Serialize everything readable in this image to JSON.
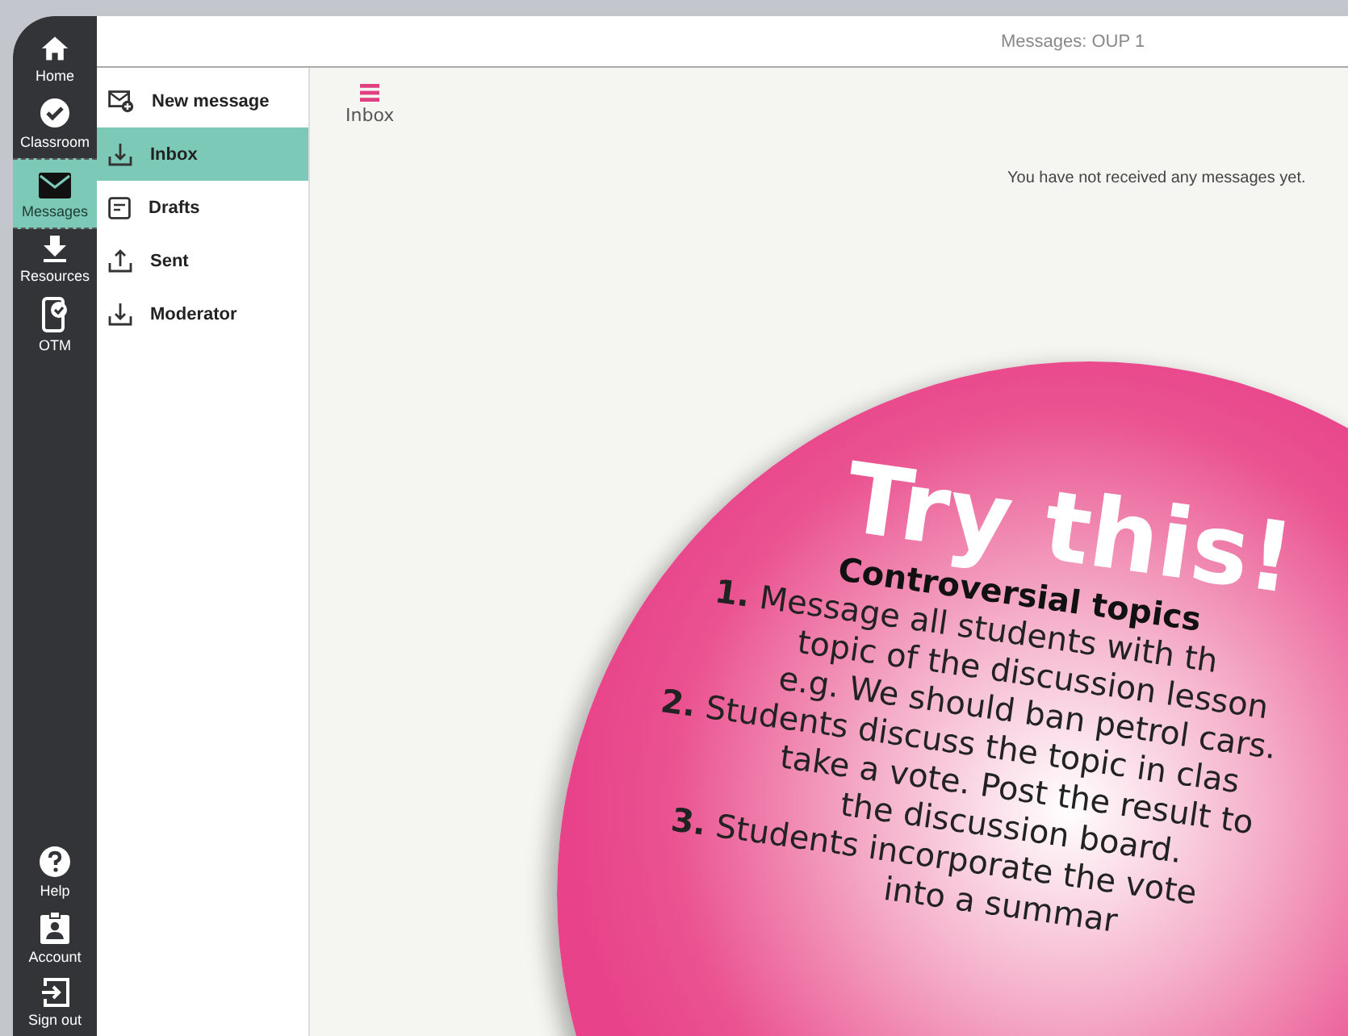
{
  "window": {
    "title": "Messages: OUP 1"
  },
  "nav_rail": {
    "items": [
      {
        "label": "Home",
        "selected": false
      },
      {
        "label": "Classroom",
        "selected": false
      },
      {
        "label": "Messages",
        "selected": true
      },
      {
        "label": "Resources",
        "selected": false
      },
      {
        "label": "OTM",
        "selected": false
      }
    ],
    "bottom_items": [
      {
        "label": "Help"
      },
      {
        "label": "Account"
      },
      {
        "label": "Sign out"
      }
    ]
  },
  "sidebar": {
    "items": [
      {
        "label": "New message",
        "selected": false
      },
      {
        "label": "Inbox",
        "selected": true
      },
      {
        "label": "Drafts",
        "selected": false
      },
      {
        "label": "Sent",
        "selected": false
      },
      {
        "label": "Moderator",
        "selected": false
      }
    ]
  },
  "content": {
    "menu_label": "Inbox",
    "empty_message": "You have not received any messages yet."
  },
  "promo": {
    "title": "Try this!",
    "subtitle": "Controversial topics",
    "lines": [
      "**1.** Message all students with th",
      "topic of the discussion lesson",
      "e.g. We should ban petrol cars.",
      "**2.** Students discuss  the topic in clas",
      "take a vote. Post the result to",
      "the discussion board.",
      "**3.** Students incorporate the vote",
      "into a summar"
    ]
  }
}
